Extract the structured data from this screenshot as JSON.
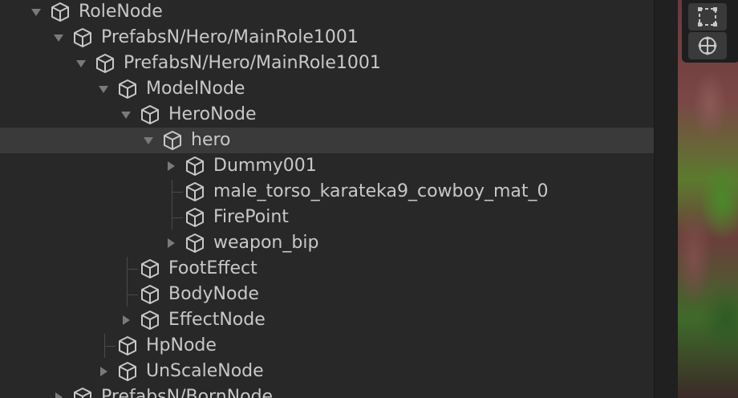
{
  "hierarchy": {
    "nodes": [
      {
        "label": "RoleNode",
        "foldout": "expanded"
      },
      {
        "label": "PrefabsN/Hero/MainRole1001",
        "foldout": "expanded"
      },
      {
        "label": "PrefabsN/Hero/MainRole1001",
        "foldout": "expanded"
      },
      {
        "label": "ModelNode",
        "foldout": "expanded"
      },
      {
        "label": "HeroNode",
        "foldout": "expanded"
      },
      {
        "label": "hero",
        "foldout": "expanded",
        "selected": true
      },
      {
        "label": "Dummy001",
        "foldout": "collapsed"
      },
      {
        "label": "male_torso_karateka9_cowboy_mat_0",
        "foldout": "none"
      },
      {
        "label": "FirePoint",
        "foldout": "none"
      },
      {
        "label": "weapon_bip",
        "foldout": "collapsed"
      },
      {
        "label": "FootEffect",
        "foldout": "none"
      },
      {
        "label": "BodyNode",
        "foldout": "none"
      },
      {
        "label": "EffectNode",
        "foldout": "collapsed"
      },
      {
        "label": "HpNode",
        "foldout": "none"
      },
      {
        "label": "UnScaleNode",
        "foldout": "collapsed"
      },
      {
        "label": "PrefabsN/BornNode",
        "foldout": "collapsed"
      }
    ]
  },
  "scene_toolbar": {
    "tools": [
      {
        "icon": "rect-tool-icon"
      },
      {
        "icon": "transform-tool-icon"
      }
    ]
  },
  "colors": {
    "panel_bg": "#282828",
    "selected_row": "#3a3a3a",
    "text": "#c8c8c8",
    "icon": "#c8c8c8"
  }
}
